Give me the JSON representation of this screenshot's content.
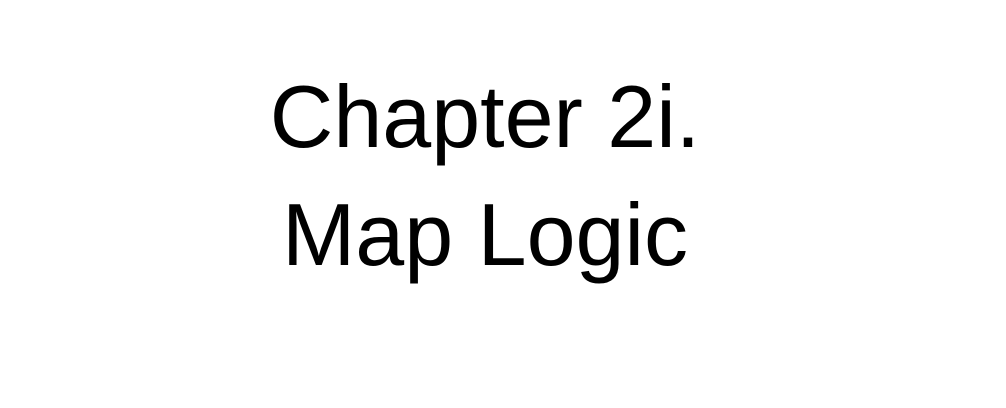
{
  "slide": {
    "title_line_1": "Chapter 2i.",
    "title_line_2": "Map Logic",
    "background_color": "#ffffff",
    "text_color": "#000000"
  }
}
